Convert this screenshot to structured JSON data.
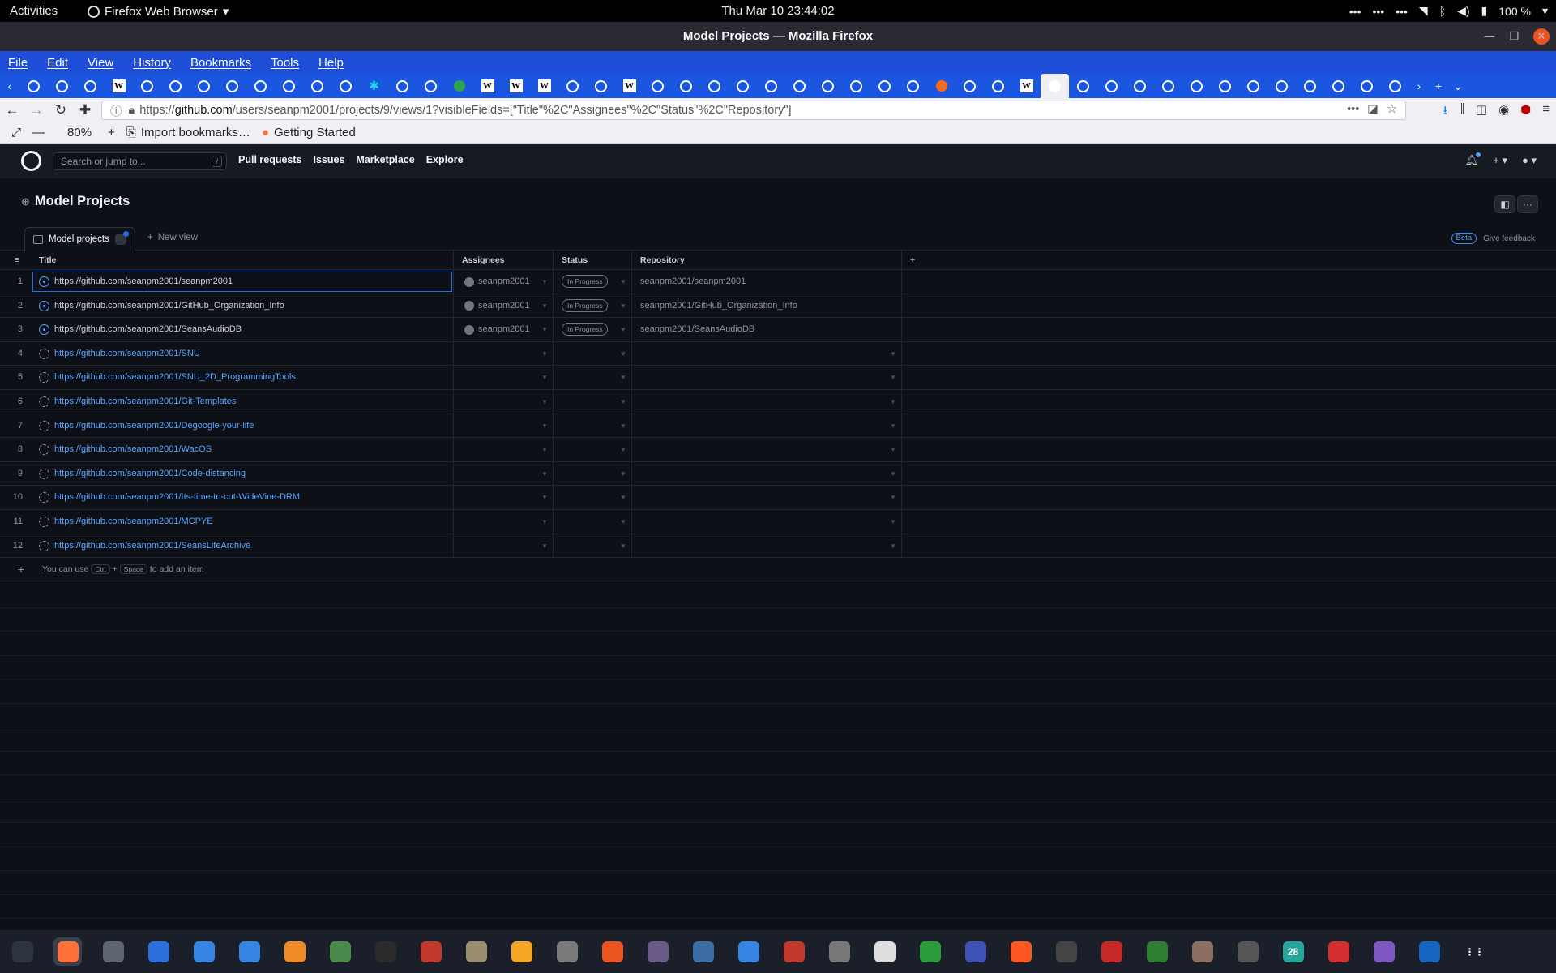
{
  "system_bar": {
    "activities": "Activities",
    "app_name": "Firefox Web Browser",
    "clock": "Thu Mar 10  23:44:02",
    "battery": "100 %"
  },
  "window": {
    "title": "Model Projects — Mozilla Firefox"
  },
  "menubar": [
    "File",
    "Edit",
    "View",
    "History",
    "Bookmarks",
    "Tools",
    "Help"
  ],
  "tabs": [
    "github",
    "github",
    "github",
    "wikipedia",
    "github",
    "github",
    "github",
    "github",
    "github",
    "github",
    "github",
    "github",
    "teal",
    "github",
    "github",
    "green",
    "wikipedia",
    "wikipedia",
    "wikipedia",
    "github",
    "github",
    "wikipedia",
    "github",
    "github",
    "github",
    "github",
    "github",
    "github",
    "github",
    "github",
    "github",
    "github",
    "orange",
    "github",
    "github",
    "wikipedia",
    "active-github",
    "github",
    "github",
    "github",
    "github",
    "github",
    "github",
    "github",
    "github",
    "github",
    "github",
    "github",
    "github"
  ],
  "navbar": {
    "url_prefix": "https://",
    "url_domain": "github.com",
    "url_path": "/users/seanpm2001/projects/9/views/1?visibleFields=[\"Title\"%2C\"Assignees\"%2C\"Status\"%2C\"Repository\"]"
  },
  "bookmarks": {
    "zoom": "80%",
    "items": [
      "Import bookmarks…",
      "Getting Started"
    ]
  },
  "github_header": {
    "search_placeholder": "Search or jump to...",
    "search_shortcut": "/",
    "nav": [
      "Pull requests",
      "Issues",
      "Marketplace",
      "Explore"
    ]
  },
  "project": {
    "title": "Model Projects",
    "view_tab": "Model projects",
    "new_view": "New view",
    "beta": "Beta",
    "feedback": "Give feedback"
  },
  "table": {
    "columns": [
      "Title",
      "Assignees",
      "Status",
      "Repository"
    ],
    "rows": [
      {
        "num": "1",
        "title": "https://github.com/seanpm2001/seanpm2001",
        "type": "issue",
        "assignee": "seanpm2001",
        "status": "In Progress",
        "repo": "seanpm2001/seanpm2001"
      },
      {
        "num": "2",
        "title": "https://github.com/seanpm2001/GitHub_Organization_Info",
        "type": "issue",
        "assignee": "seanpm2001",
        "status": "In Progress",
        "repo": "seanpm2001/GitHub_Organization_Info"
      },
      {
        "num": "3",
        "title": "https://github.com/seanpm2001/SeansAudioDB",
        "type": "issue",
        "assignee": "seanpm2001",
        "status": "In Progress",
        "repo": "seanpm2001/SeansAudioDB"
      },
      {
        "num": "4",
        "title": "https://github.com/seanpm2001/SNU",
        "type": "draft",
        "assignee": "",
        "status": "",
        "repo": ""
      },
      {
        "num": "5",
        "title": "https://github.com/seanpm2001/SNU_2D_ProgrammingTools",
        "type": "draft",
        "assignee": "",
        "status": "",
        "repo": ""
      },
      {
        "num": "6",
        "title": "https://github.com/seanpm2001/Git-Templates",
        "type": "draft",
        "assignee": "",
        "status": "",
        "repo": ""
      },
      {
        "num": "7",
        "title": "https://github.com/seanpm2001/Degoogle-your-life",
        "type": "draft",
        "assignee": "",
        "status": "",
        "repo": ""
      },
      {
        "num": "8",
        "title": "https://github.com/seanpm2001/WacOS",
        "type": "draft",
        "assignee": "",
        "status": "",
        "repo": ""
      },
      {
        "num": "9",
        "title": "https://github.com/seanpm2001/Code-distancing",
        "type": "draft",
        "assignee": "",
        "status": "",
        "repo": ""
      },
      {
        "num": "10",
        "title": "https://github.com/seanpm2001/Its-time-to-cut-WideVine-DRM",
        "type": "draft",
        "assignee": "",
        "status": "",
        "repo": ""
      },
      {
        "num": "11",
        "title": "https://github.com/seanpm2001/MCPYE",
        "type": "draft",
        "assignee": "",
        "status": "",
        "repo": ""
      },
      {
        "num": "12",
        "title": "https://github.com/seanpm2001/SeansLifeArchive",
        "type": "draft",
        "assignee": "",
        "status": "",
        "repo": ""
      }
    ],
    "add_hint_prefix": "You can use",
    "add_hint_key1": "Ctrl",
    "add_hint_plus": "+",
    "add_hint_key2": "Space",
    "add_hint_suffix": "to add an item"
  },
  "dock": [
    "system-monitor",
    "firefox",
    "settings",
    "writer",
    "help",
    "text-editor",
    "vlc",
    "gimp-addon",
    "terminal",
    "monitor",
    "files",
    "calculator",
    "image-viewer",
    "app-store",
    "rhythm",
    "inkscape",
    "todo",
    "document-viewer",
    "archive",
    "character-map",
    "vim",
    "screen",
    "update",
    "music",
    "pdf-reader",
    "spreadsheet",
    "game",
    "bird",
    "calendar",
    "alert",
    "camera",
    "install",
    "app-grid"
  ],
  "dock_calendar_day": "28"
}
